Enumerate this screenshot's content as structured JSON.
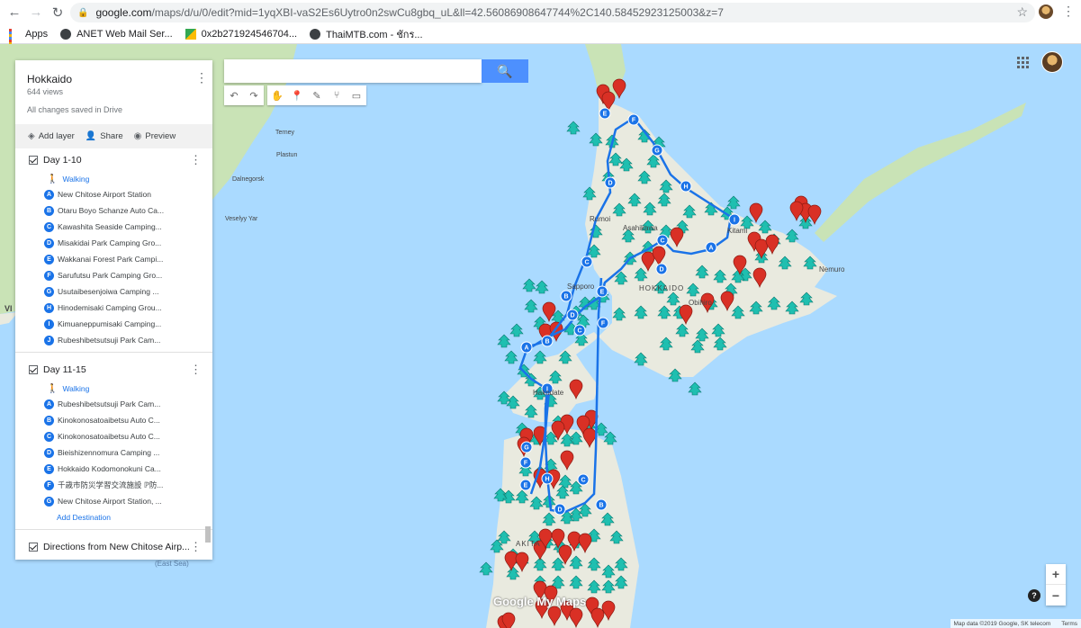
{
  "browser": {
    "url_host": "google.com",
    "url_rest": "/maps/d/u/0/edit?mid=1yqXBI-vaS2Es6Uytro0n2swCu8gbq_uL&ll=42.56086908647744%2C140.58452923125003&z=7",
    "bookmarks": [
      "Apps",
      "ANET Web Mail Ser...",
      "0x2b27192454670​4...",
      "ThaiMTB.com - ชักร..."
    ]
  },
  "panel": {
    "title": "Hokkaido",
    "views": "644 views",
    "saved": "All changes saved in Drive",
    "actions": {
      "add_layer": "Add layer",
      "share": "Share",
      "preview": "Preview"
    }
  },
  "layers": [
    {
      "title": "Day 1-10",
      "mode": "Walking",
      "stops": [
        {
          "letter": "A",
          "name": "New Chitose Airport Station"
        },
        {
          "letter": "B",
          "name": "Otaru Boyo Schanze Auto Ca..."
        },
        {
          "letter": "C",
          "name": "Kawashita Seaside Camping..."
        },
        {
          "letter": "D",
          "name": "Misakidai Park Camping Gro..."
        },
        {
          "letter": "E",
          "name": "Wakkanai Forest Park Campi..."
        },
        {
          "letter": "F",
          "name": "Sarufutsu Park Camping Gro..."
        },
        {
          "letter": "G",
          "name": "Usutaibesenjoiwa Camping ..."
        },
        {
          "letter": "H",
          "name": "Hinodemisaki Camping Grou..."
        },
        {
          "letter": "I",
          "name": "Kimuaneppumisaki Camping..."
        },
        {
          "letter": "J",
          "name": "Rubeshibetsutsuji Park Cam..."
        }
      ]
    },
    {
      "title": "Day 11-15",
      "mode": "Walking",
      "stops": [
        {
          "letter": "A",
          "name": "Rubeshibetsutsuji Park Cam..."
        },
        {
          "letter": "B",
          "name": "Kinokonosatoaibetsu Auto C..."
        },
        {
          "letter": "C",
          "name": "Kinokonosatoaibetsu Auto C..."
        },
        {
          "letter": "D",
          "name": "Bieishizennomura Camping ..."
        },
        {
          "letter": "E",
          "name": "Hokkaido Kodomonokuni Ca..."
        },
        {
          "letter": "F",
          "name": "千歳市防災学習交流施設 ℙ防..."
        },
        {
          "letter": "G",
          "name": "New Chitose Airport Station, ..."
        }
      ],
      "add_destination": "Add Destination"
    },
    {
      "title": "Directions from New Chitose Airp..."
    }
  ],
  "map": {
    "labels": {
      "nemuro": "Nemuro",
      "hokkaido": "HOKKAIDO",
      "akita": "AKITA",
      "east_sea": "(East Sea)",
      "sapporo": "Sapporo",
      "obihiro": "Obihiro",
      "rumoi": "Rumoi",
      "kitami": "Kitami",
      "asahikawa": "Asahikawa",
      "hakodate": "Hakodate",
      "plastun": "Plastun",
      "terney": "Terney",
      "dalnegorsk": "Dalnegorsk",
      "veselyy_yar": "Veselyy Yar",
      "vl": "Vl"
    },
    "brand": "Google My Maps",
    "attribution": "Map data ©2019 Google, SK telecom",
    "terms": "Terms",
    "zoom_in": "+",
    "zoom_out": "−",
    "help": "?",
    "colors": {
      "water": "#aadaff",
      "land": "#e9eadf",
      "forest": "#c9e3b6",
      "route": "#1a73e8",
      "tree": "#1fbfb0",
      "pin": "#d93025"
    }
  }
}
